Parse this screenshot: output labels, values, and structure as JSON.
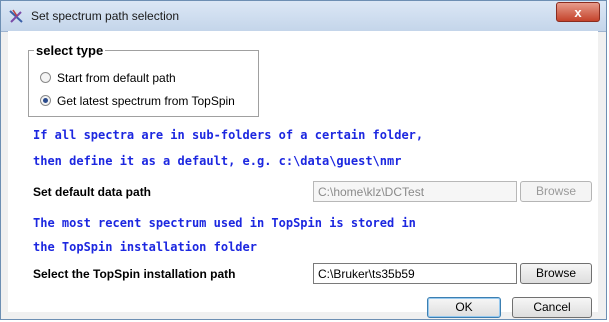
{
  "window": {
    "title": "Set spectrum path selection",
    "close_label": "x"
  },
  "select_type": {
    "title": "select type",
    "options": [
      {
        "label": "Start from default path",
        "selected": false
      },
      {
        "label": "Get latest spectrum from TopSpin",
        "selected": true
      }
    ]
  },
  "info1": {
    "line1": "If all spectra are in sub-folders of a certain folder,",
    "line2": "then define it as a default, e.g. c:\\data\\guest\\nmr"
  },
  "default_path": {
    "label": "Set default data path",
    "value": "C:\\home\\klz\\DCTest",
    "browse_label": "Browse"
  },
  "info2": {
    "line1": "The most recent spectrum used in TopSpin is stored in",
    "line2": "the TopSpin installation folder"
  },
  "topspin_path": {
    "label": "Select the TopSpin installation path",
    "value": "C:\\Bruker\\ts35b59",
    "browse_label": "Browse"
  },
  "buttons": {
    "ok": "OK",
    "cancel": "Cancel"
  }
}
